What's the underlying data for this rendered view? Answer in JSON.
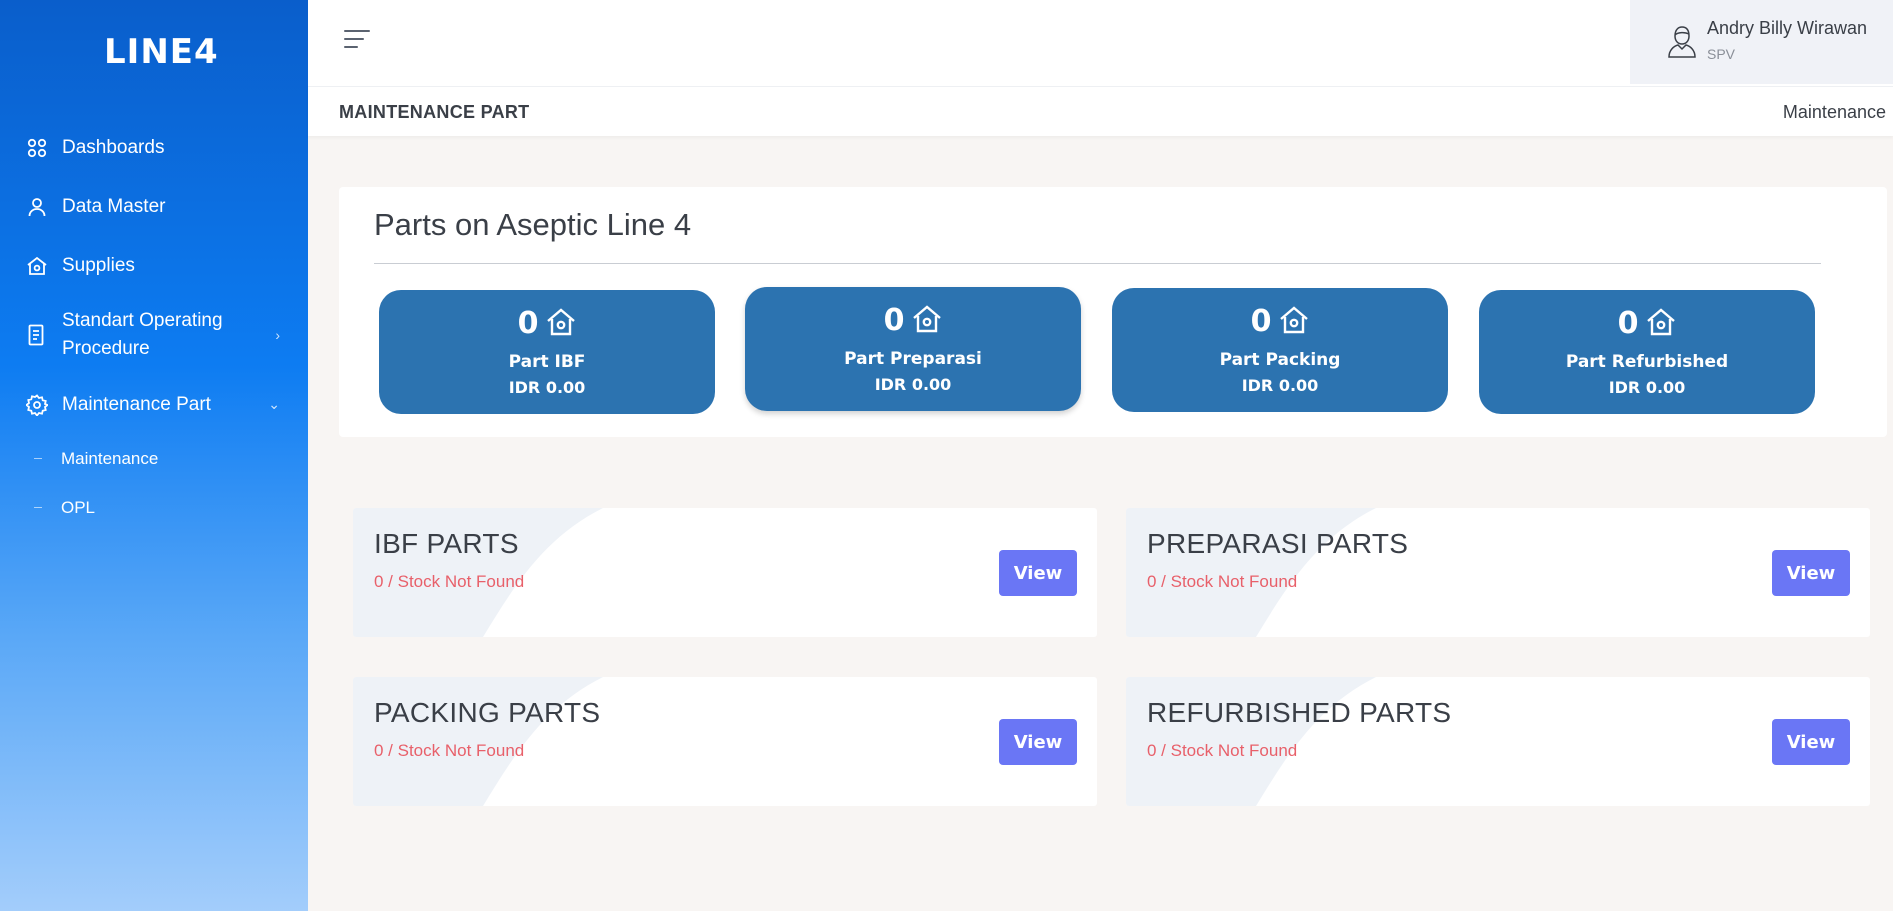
{
  "app": {
    "logo_text": "LINE4"
  },
  "sidebar": {
    "items": [
      {
        "label": "Dashboards",
        "icon": "dashboard-icon"
      },
      {
        "label": "Data Master",
        "icon": "user-icon"
      },
      {
        "label": "Supplies",
        "icon": "home-gear-icon"
      },
      {
        "label": "Standart Operating Procedure",
        "icon": "document-icon",
        "chevron": "›"
      },
      {
        "label": "Maintenance Part",
        "icon": "gear-icon",
        "chevron": "⌄"
      }
    ],
    "sub_items": [
      {
        "label": "Maintenance"
      },
      {
        "label": "OPL"
      }
    ]
  },
  "header": {
    "user_name": "Andry Billy Wirawan",
    "user_role": "SPV"
  },
  "subheader": {
    "page_title": "MAINTENANCE PART",
    "breadcrumb": "Maintenance"
  },
  "summary": {
    "title": "Parts on Aseptic Line 4",
    "stats": [
      {
        "count": "0",
        "label": "Part IBF",
        "amount": "IDR 0.00"
      },
      {
        "count": "0",
        "label": "Part Preparasi",
        "amount": "IDR 0.00"
      },
      {
        "count": "0",
        "label": "Part Packing",
        "amount": "IDR 0.00"
      },
      {
        "count": "0",
        "label": "Part Refurbished",
        "amount": "IDR 0.00"
      }
    ]
  },
  "parts": [
    {
      "title": "IBF PARTS",
      "status": "0 / Stock Not Found",
      "button": "View"
    },
    {
      "title": "PREPARASI PARTS",
      "status": "0 / Stock Not Found",
      "button": "View"
    },
    {
      "title": "PACKING PARTS",
      "status": "0 / Stock Not Found",
      "button": "View"
    },
    {
      "title": "REFURBISHED PARTS",
      "status": "0 / Stock Not Found",
      "button": "View"
    }
  ],
  "colors": {
    "sidebar_top": "#0a5ecb",
    "sidebar_bottom": "#a3cdfb",
    "stat_card": "#2c73b0",
    "view_button": "#6a76f5",
    "status_text": "#e8606a"
  }
}
